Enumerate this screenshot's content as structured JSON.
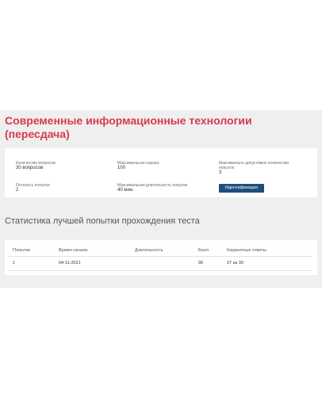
{
  "course": {
    "title": "Современные информационные технологии (пересдача)"
  },
  "info": {
    "questions_label": "Количество вопросов",
    "questions_value": "30 вопросов",
    "max_score_label": "Максимальная оценка",
    "max_score_value": "100",
    "max_attempts_label": "Максимально допустимое количество попыток",
    "max_attempts_value": "3",
    "attempts_left_label": "Осталось попыток",
    "attempts_left_value": "2",
    "max_duration_label": "Максимальная длительность попытки",
    "max_duration_value": "40 мин.",
    "identify_button": "Идентификация"
  },
  "stats": {
    "title": "Статистика лучшей попытки прохождения теста",
    "columns": [
      "Попытки",
      "Время начала",
      "Длительность",
      "Балл",
      "Корректные ответы"
    ],
    "rows": [
      [
        "1",
        "04-11-2021",
        "",
        "90",
        "27 из 30"
      ]
    ]
  },
  "colors": {
    "title_red": "#d63a4c",
    "button_blue": "#1d4e7c",
    "panel_gray": "#efefef"
  }
}
